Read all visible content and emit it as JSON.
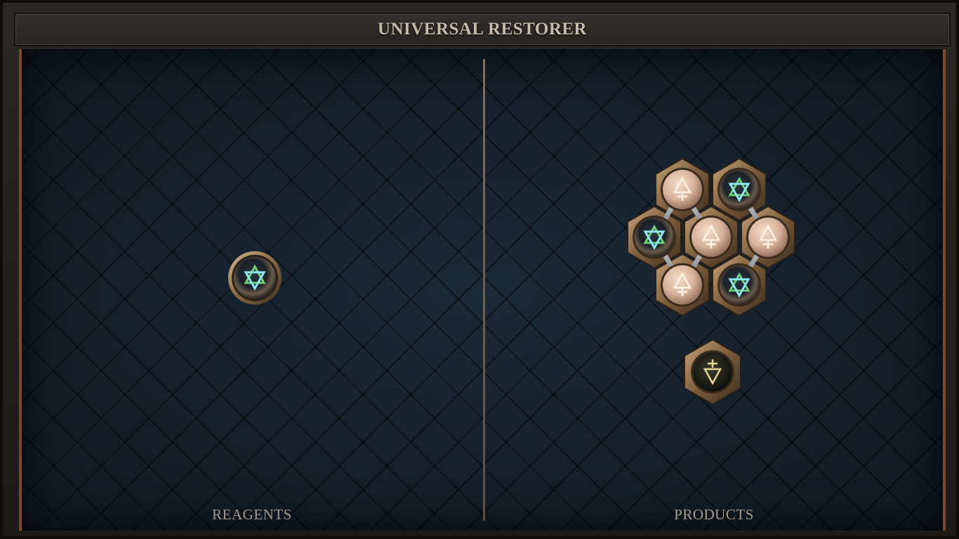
{
  "window": {
    "title": "UNIVERSAL RESTORER"
  },
  "reagents": {
    "label": "REAGENTS",
    "items": [
      {
        "icon": "hexagram-glyph-icon",
        "orb": "dark-iridescent"
      }
    ]
  },
  "products": {
    "label": "PRODUCTS",
    "cluster": {
      "nodes": [
        {
          "icon": "up-arrow-cross-glyph-icon",
          "orb": "pale-copper"
        },
        {
          "icon": "hexagram-glyph-icon",
          "orb": "dark-iridescent"
        },
        {
          "icon": "hexagram-glyph-icon",
          "orb": "dark-iridescent"
        },
        {
          "icon": "up-arrow-cross-glyph-icon",
          "orb": "pale-copper"
        },
        {
          "icon": "up-arrow-cross-glyph-icon",
          "orb": "pale-copper"
        },
        {
          "icon": "up-arrow-cross-glyph-icon",
          "orb": "pale-copper"
        },
        {
          "icon": "hexagram-glyph-icon",
          "orb": "dark-iridescent"
        }
      ]
    },
    "single": {
      "icon": "down-arrow-cross-glyph-icon",
      "orb": "dark-olive"
    }
  },
  "colors": {
    "frame": "#1c1a18",
    "board": "#111c26",
    "accent_border": "#7a4a2a",
    "title_text": "#c6bba8",
    "label_text": "#a79a88",
    "bronze": "#8a6a45",
    "glyph_green": "#6fd07a",
    "glyph_cyan": "#8fe6f0"
  }
}
